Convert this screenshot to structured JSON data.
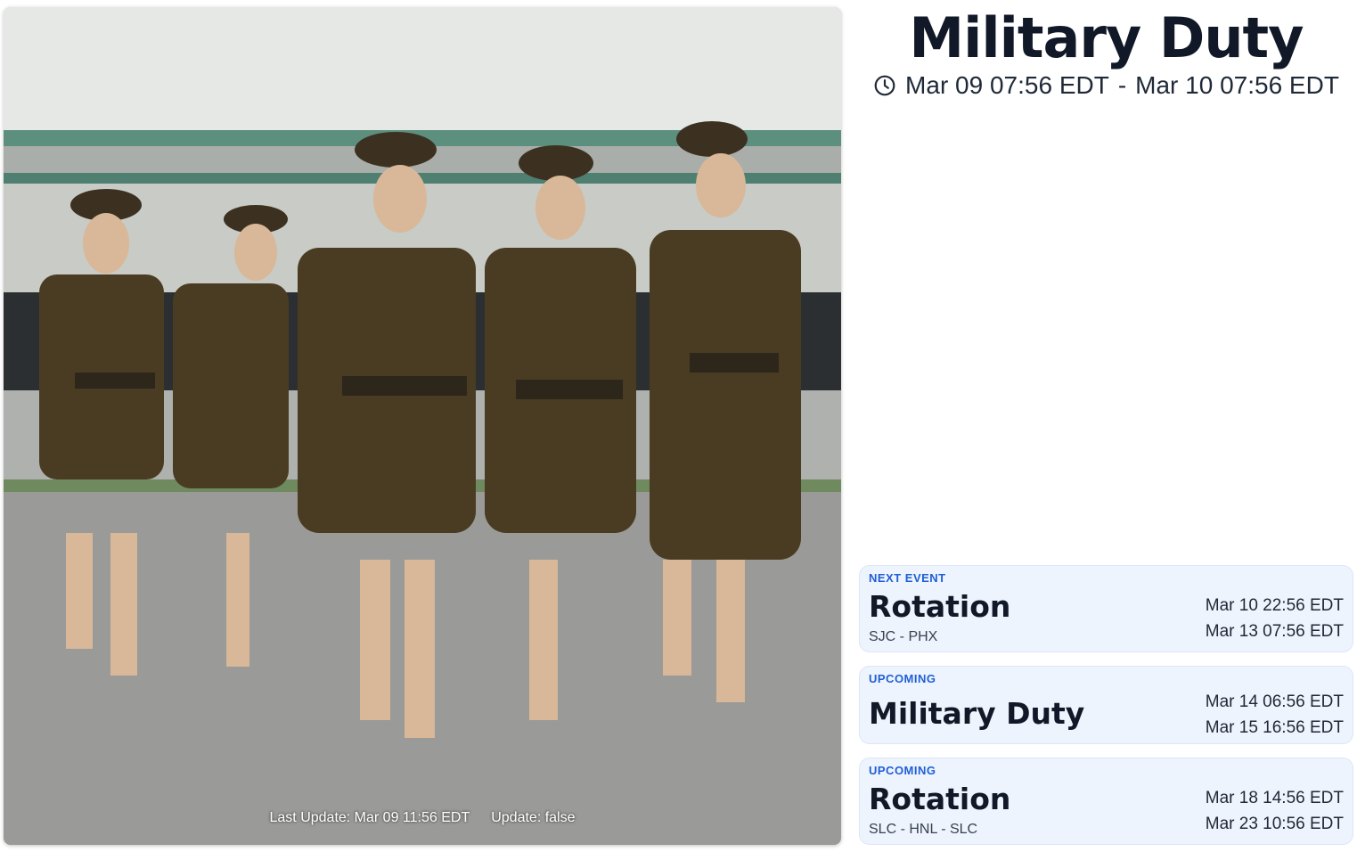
{
  "header": {
    "title": "Military Duty",
    "range_start": "Mar 09 07:56 EDT",
    "range_separator": "-",
    "range_end": "Mar 10 07:56 EDT",
    "clock_icon": "clock-icon"
  },
  "photo": {
    "last_update": "Last Update: Mar 09 11:56 EDT",
    "update_flag": "Update: false"
  },
  "events": [
    {
      "tag": "NEXT EVENT",
      "title": "Rotation",
      "route": "SJC - PHX",
      "start": "Mar 10 22:56 EDT",
      "end": "Mar 13 07:56 EDT"
    },
    {
      "tag": "UPCOMING",
      "title": "Military Duty",
      "route": "",
      "start": "Mar 14 06:56 EDT",
      "end": "Mar 15 16:56 EDT"
    },
    {
      "tag": "UPCOMING",
      "title": "Rotation",
      "route": "SLC - HNL - SLC",
      "start": "Mar 18 14:56 EDT",
      "end": "Mar 23 10:56 EDT"
    }
  ],
  "colors": {
    "accent": "#1f5fd6",
    "card_bg": "#eef4fd",
    "text": "#111827"
  }
}
